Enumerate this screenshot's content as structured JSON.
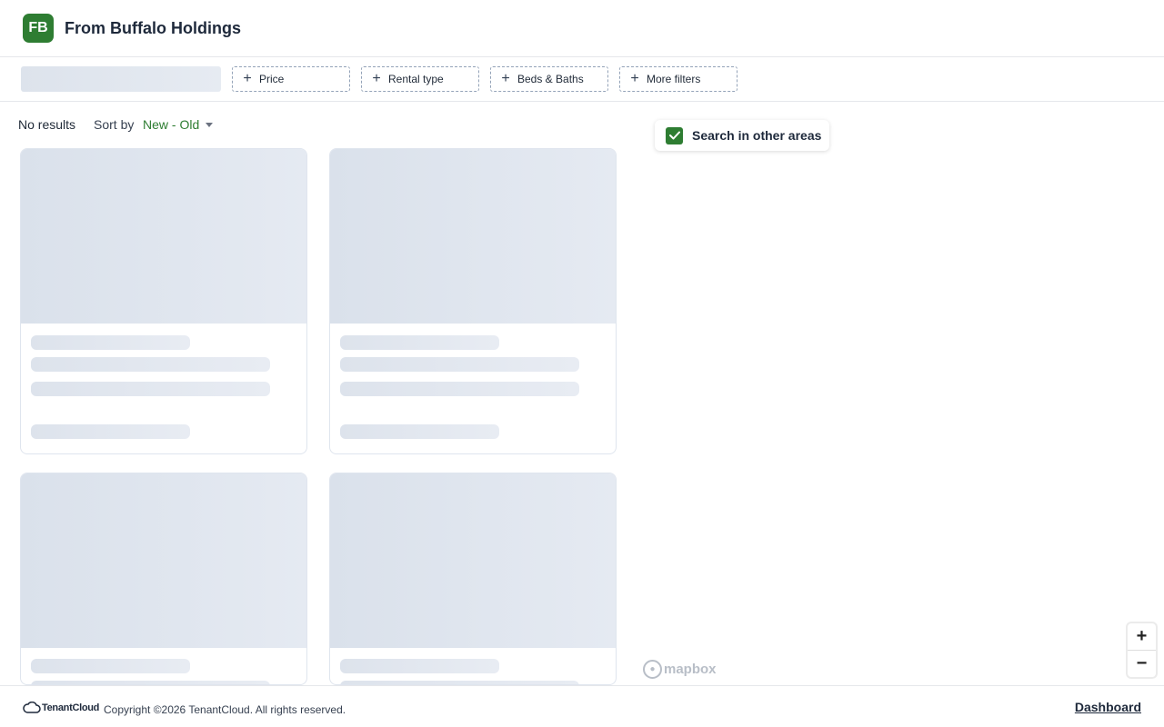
{
  "header": {
    "logo_initials": "FB",
    "company_name": "From Buffalo Holdings",
    "brand_color": "#2e7d32"
  },
  "filters": {
    "buttons": [
      {
        "icon": "plus-icon",
        "label": "Price"
      },
      {
        "icon": "plus-icon",
        "label": "Rental type"
      },
      {
        "icon": "plus-icon",
        "label": "Beds & Baths"
      },
      {
        "icon": "plus-icon",
        "label": "More filters"
      }
    ]
  },
  "results": {
    "count_text": "No results",
    "sort_label": "Sort by",
    "sort_value": "New - Old",
    "sort_icon": "caret-down-icon"
  },
  "map": {
    "search_other_areas_label": "Search in other areas",
    "search_other_areas_checked": true,
    "attribution": "mapbox",
    "zoom_in_label": "+",
    "zoom_out_label": "−"
  },
  "footer": {
    "brand": "TenantCloud",
    "copyright": "Copyright ©2026 TenantCloud. All rights reserved.",
    "dashboard_link": "Dashboard"
  }
}
